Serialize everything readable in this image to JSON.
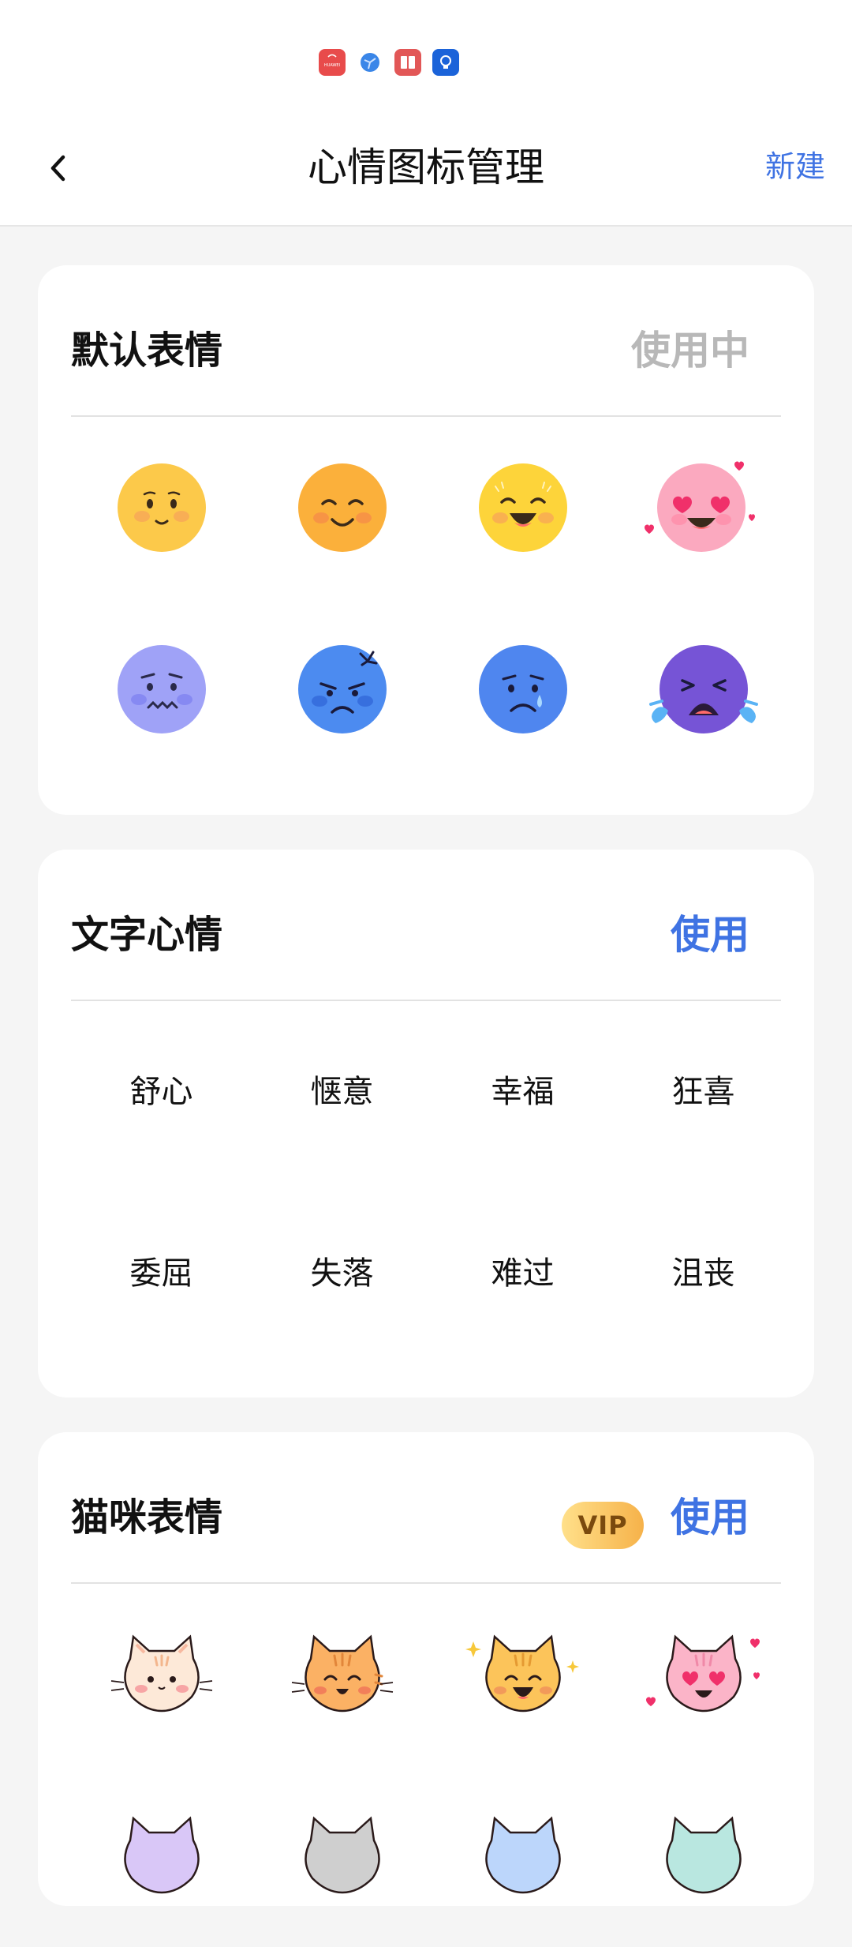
{
  "header": {
    "title": "心情图标管理",
    "action_label": "新建",
    "back_icon": "chevron-left-icon"
  },
  "status_bar": {
    "icons": [
      "huawei-app-icon",
      "network-icon",
      "book-icon",
      "lightbulb-icon"
    ],
    "huawei_label": "HUAWEI"
  },
  "cards": {
    "default": {
      "title": "默认表情",
      "status": "使用中",
      "icons": [
        "shy-face-icon",
        "content-face-icon",
        "happy-face-icon",
        "heart-eyes-face-icon",
        "worried-face-icon",
        "angry-face-icon",
        "sad-tear-face-icon",
        "crying-face-icon"
      ]
    },
    "text": {
      "title": "文字心情",
      "status": "使用",
      "words": [
        "舒心",
        "惬意",
        "幸福",
        "狂喜",
        "委屈",
        "失落",
        "难过",
        "沮丧"
      ]
    },
    "cat": {
      "title": "猫咪表情",
      "badge": "VIP",
      "status": "使用",
      "icons": [
        "cat-shy-icon",
        "cat-smile-icon",
        "cat-happy-icon",
        "cat-heart-eyes-icon",
        "cat-purple-icon",
        "cat-gray-icon",
        "cat-blue-icon",
        "cat-teal-icon"
      ]
    }
  },
  "colors": {
    "accent": "#3f73e3",
    "muted": "#b8b8b8",
    "background": "#f5f5f5",
    "card": "#ffffff"
  }
}
